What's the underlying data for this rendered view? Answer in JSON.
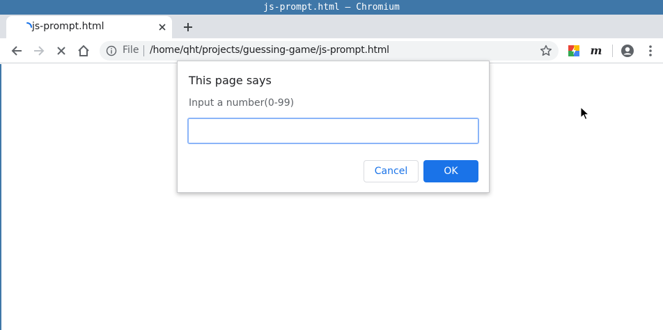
{
  "window": {
    "title": "js-prompt.html – Chromium"
  },
  "tabs": [
    {
      "title": "js-prompt.html",
      "loading": true
    }
  ],
  "toolbar": {
    "omnibox": {
      "scheme_label": "File",
      "url": "/home/qht/projects/guessing-game/js-prompt.html"
    },
    "icons": [
      "back-icon",
      "forward-icon",
      "stop-icon",
      "home-icon",
      "info-icon",
      "star-icon",
      "extension-icon",
      "extension-m-icon",
      "profile-icon",
      "menu-icon"
    ],
    "extension_m_glyph": "m"
  },
  "dialog": {
    "title": "This page says",
    "message": "Input a number(0-99)",
    "input_value": "",
    "cancel_label": "Cancel",
    "ok_label": "OK"
  },
  "colors": {
    "titlebar": "#3f77a8",
    "tabstrip": "#dee1e6",
    "accent": "#1a73e8",
    "omnibox_bg": "#f1f3f4"
  }
}
